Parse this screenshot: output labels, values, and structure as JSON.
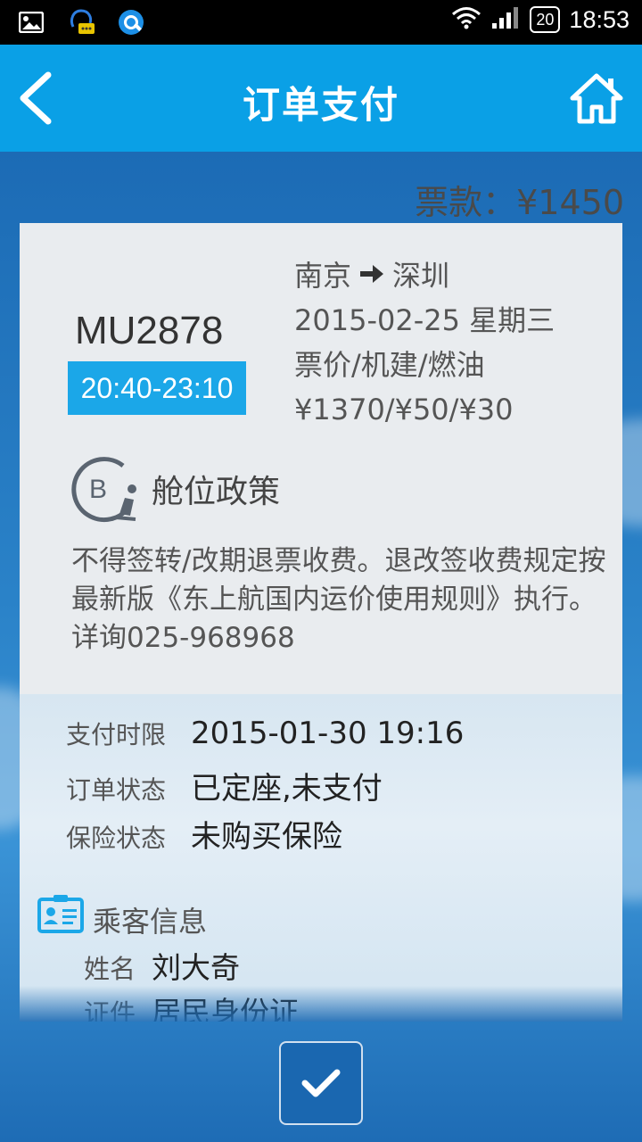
{
  "status_bar": {
    "time": "18:53",
    "battery": "20",
    "left_icons": [
      "image-icon",
      "chat-bubble-icon",
      "browser-icon"
    ],
    "right_icons": [
      "wifi-icon",
      "signal-icon",
      "battery-icon"
    ]
  },
  "header": {
    "title": "订单支付",
    "back_icon": "back-arrow-icon",
    "home_icon": "home-icon",
    "bg_color": "#0aa0e6"
  },
  "ticket_amount": "票款：¥1450",
  "flight": {
    "number": "MU2878",
    "time": "20:40-23:10",
    "from": "南京",
    "to": "深圳",
    "date": "2015-02-25 星期三",
    "fee_labels": "票价/机建/燃油",
    "fee_values": "¥1370/¥50/¥30"
  },
  "cabin": {
    "letter": "B",
    "title": "舱位政策",
    "policy": "不得签转/改期退票收费。退改签收费规定按最新版《东上航国内运价使用规则》执行。详询025-968968"
  },
  "payment": [
    {
      "label": "支付时限",
      "value": "2015-01-30 19:16"
    },
    {
      "label": "订单状态",
      "value": "已定座,未支付"
    },
    {
      "label": "保险状态",
      "value": "未购买保险"
    }
  ],
  "passenger": {
    "title": "乘客信息",
    "name_label": "姓名",
    "name": "刘大奇",
    "id_label": "证件",
    "id_type": "居民身份证"
  },
  "confirm_icon": "checkmark-icon",
  "colors": {
    "accent": "#1ba7e8",
    "background": "#1e6fb8"
  }
}
